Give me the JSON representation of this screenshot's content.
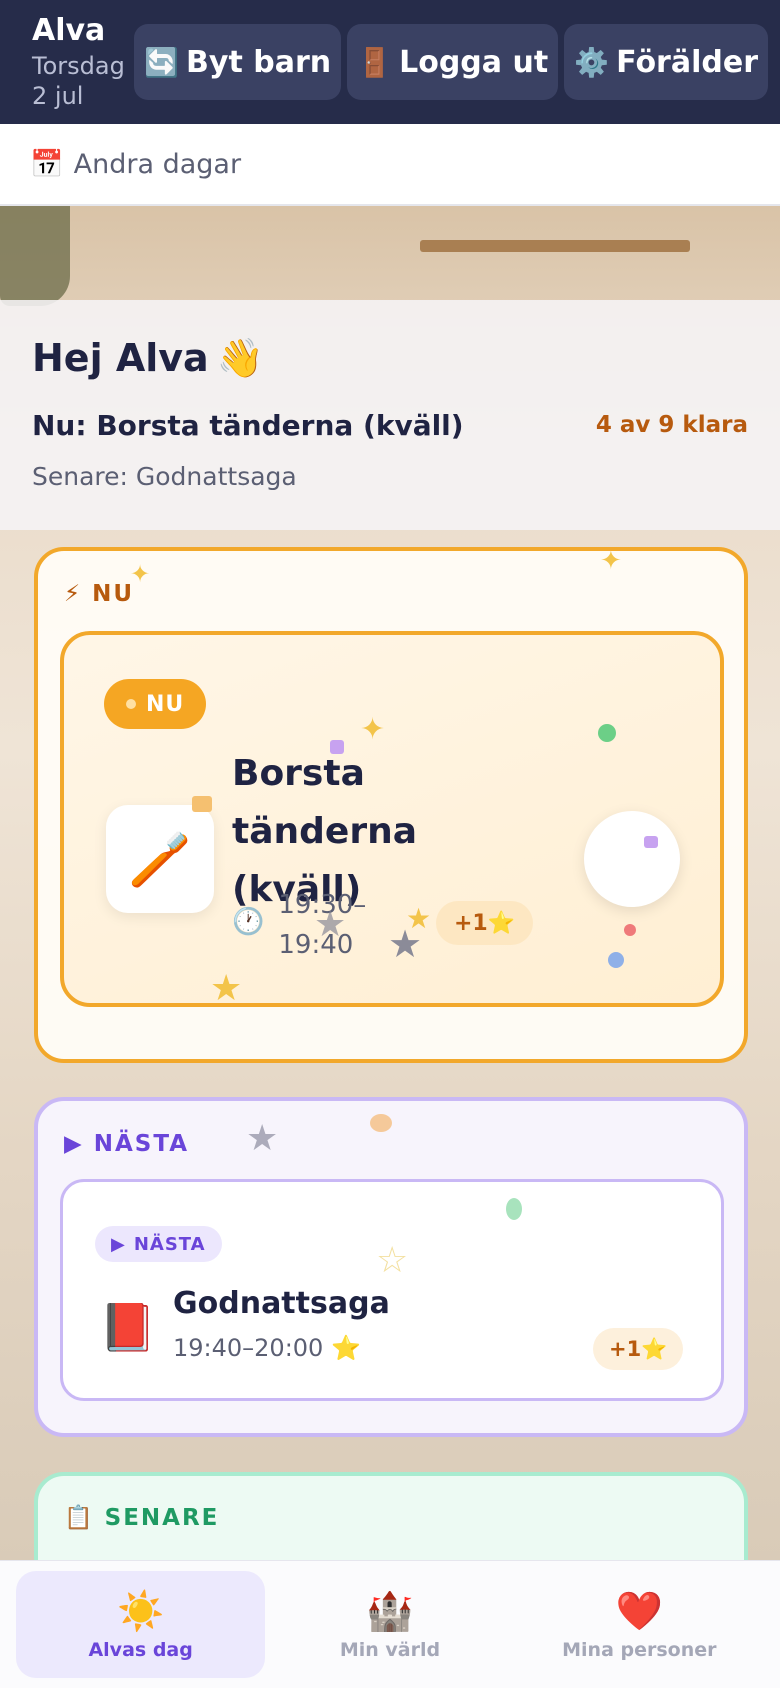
{
  "header": {
    "child_name": "Alva",
    "date": "Torsdag 2 jul",
    "buttons": [
      {
        "icon": "🔄",
        "label": "Byt barn"
      },
      {
        "icon": "🚪",
        "label": "Logga ut"
      },
      {
        "icon": "⚙️",
        "label": "Förälder"
      }
    ]
  },
  "days_bar": {
    "icon": "📅",
    "label": "Andra dagar"
  },
  "greeting": {
    "hello": "Hej Alva",
    "wave": "👋",
    "now_line": "Nu: Borsta tänderna (kväll)",
    "progress": "4 av 9 klara",
    "later_line": "Senare: Godnattsaga"
  },
  "sections": {
    "now": {
      "icon": "⚡",
      "heading": "NU",
      "task": {
        "badge": "NU",
        "icon": "🪥",
        "title": "Borsta tänderna (kväll)",
        "time_start": "19:30–",
        "time_end": "19:40",
        "clock_icon": "🕐",
        "reward": "+1⭐"
      }
    },
    "next": {
      "icon": "▶",
      "heading": "NÄSTA",
      "task": {
        "badge_icon": "▶",
        "badge": "NÄSTA",
        "icon": "📕",
        "title": "Godnattsaga",
        "time": "19:40–20:00 ⭐",
        "reward": "+1⭐"
      }
    },
    "later": {
      "icon": "📋",
      "heading": "SENARE"
    }
  },
  "bottom_nav": [
    {
      "icon": "☀️",
      "label": "Alvas dag",
      "active": true
    },
    {
      "icon": "🏰",
      "label": "Min värld",
      "active": false
    },
    {
      "icon": "❤️",
      "label": "Mina personer",
      "active": false
    }
  ],
  "colors": {
    "header_bg": "#262c4a",
    "accent_orange": "#f2a82b",
    "accent_purple": "#6a45d9",
    "accent_green": "#1f9a63"
  }
}
